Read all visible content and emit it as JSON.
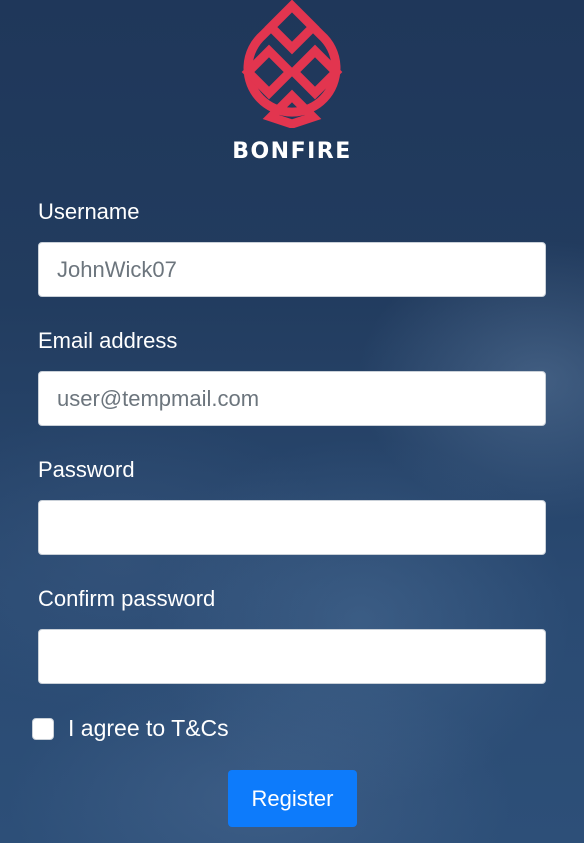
{
  "brand": {
    "name": "BONFIRE",
    "logo_icon": "bonfire-logo-icon",
    "logo_color": "#e2354f"
  },
  "form": {
    "username": {
      "label": "Username",
      "value": "",
      "placeholder": "JohnWick07"
    },
    "email": {
      "label": "Email address",
      "value": "",
      "placeholder": "user@tempmail.com"
    },
    "password": {
      "label": "Password",
      "value": "",
      "placeholder": ""
    },
    "confirm_password": {
      "label": "Confirm password",
      "value": "",
      "placeholder": ""
    },
    "terms": {
      "label": "I agree to T&Cs",
      "checked": false
    },
    "submit_label": "Register"
  },
  "colors": {
    "background": "#22395a",
    "primary_button": "#0d7bfb",
    "logo": "#e2354f"
  }
}
